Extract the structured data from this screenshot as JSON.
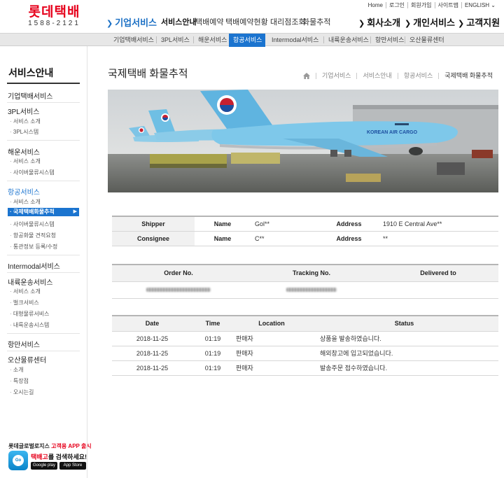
{
  "header": {
    "brand": "롯데택배",
    "phone": "1588-2121",
    "util_links": [
      "Home",
      "로그인",
      "회원가입",
      "사이트맵",
      "ENGLISH ⌄"
    ],
    "nav": {
      "corporate": "기업서비스",
      "sub_items": [
        "서비스안내",
        "택배예약",
        "택배예약현황",
        "대리점조회",
        "화물추적"
      ],
      "company": "회사소개",
      "personal": "개인서비스",
      "support": "고객지원"
    }
  },
  "subnav": [
    "기업택배서비스",
    "3PL서비스",
    "해운서비스",
    "항공서비스",
    "Intermodal서비스",
    "내륙운송서비스",
    "항만서비스",
    "오산물류센터"
  ],
  "subnav_active": "항공서비스",
  "sidebar": {
    "title": "서비스안내",
    "cats": {
      "corp": "기업택배서비스",
      "pl3": "3PL서비스",
      "sea": "해운서비스",
      "air": "항공서비스",
      "intermodal": "Intermodal서비스",
      "inland": "내륙운송서비스",
      "port": "항만서비스",
      "osan": "오산물류센터"
    },
    "items": {
      "pl3_intro": "서비스 소개",
      "pl3_system": "3PL시스템",
      "sea_intro": "서비스 소개",
      "sea_system": "사이버물류시스템",
      "air_intro": "서비스 소개",
      "air_track": "국제택배화물추적",
      "air_cyber": "사이버물류시스템",
      "air_quote": "항공화물 견적요청",
      "air_customs": "통관정보 등록/수정",
      "inland_intro": "서비스 소개",
      "inland_bulk": "벌크서비스",
      "inland_bigcargo": "대형물류서비스",
      "inland_system": "내륙운송시스템",
      "osan_intro": "소개",
      "osan_features": "특장점",
      "osan_directions": "오시는길"
    },
    "promo": {
      "line1_prefix": "롯데글로벌로지스 ",
      "line1_accent": "고객용 APP 출시",
      "line2_accent": "택배고",
      "line2_rest": "를 검색하세요!",
      "store1": "Google play",
      "store2": "App Store",
      "app_icon": "Go"
    }
  },
  "page": {
    "title": "국제택배 화물추적",
    "breadcrumb": [
      "기업서비스",
      "서비스안내",
      "항공서비스",
      "국제택배 화물추적"
    ]
  },
  "banner": {
    "plane_text": "KOREAN AIR CARGO"
  },
  "parties": {
    "labels": [
      "Shipper",
      "Consignee"
    ],
    "name_label": "Name",
    "address_label": "Address",
    "shipper_name": "Gol**",
    "shipper_address": "1910 E Central Ave**",
    "consignee_name": "C**",
    "consignee_address": "**"
  },
  "order": {
    "headers": [
      "Order No.",
      "Tracking No.",
      "Delivered to"
    ]
  },
  "events": {
    "headers": [
      "Date",
      "Time",
      "Location",
      "Status"
    ],
    "rows": [
      {
        "date": "2018-11-25",
        "time": "01:19",
        "location": "판매자",
        "status": "상품을 발송하였습니다."
      },
      {
        "date": "2018-11-25",
        "time": "01:19",
        "location": "판매자",
        "status": "해외창고에 입고되었습니다."
      },
      {
        "date": "2018-11-25",
        "time": "01:19",
        "location": "판매자",
        "status": "발송주문 접수하였습니다."
      }
    ]
  },
  "colors": {
    "brand_red": "#e6001b",
    "accent_blue": "#1b74cf"
  }
}
